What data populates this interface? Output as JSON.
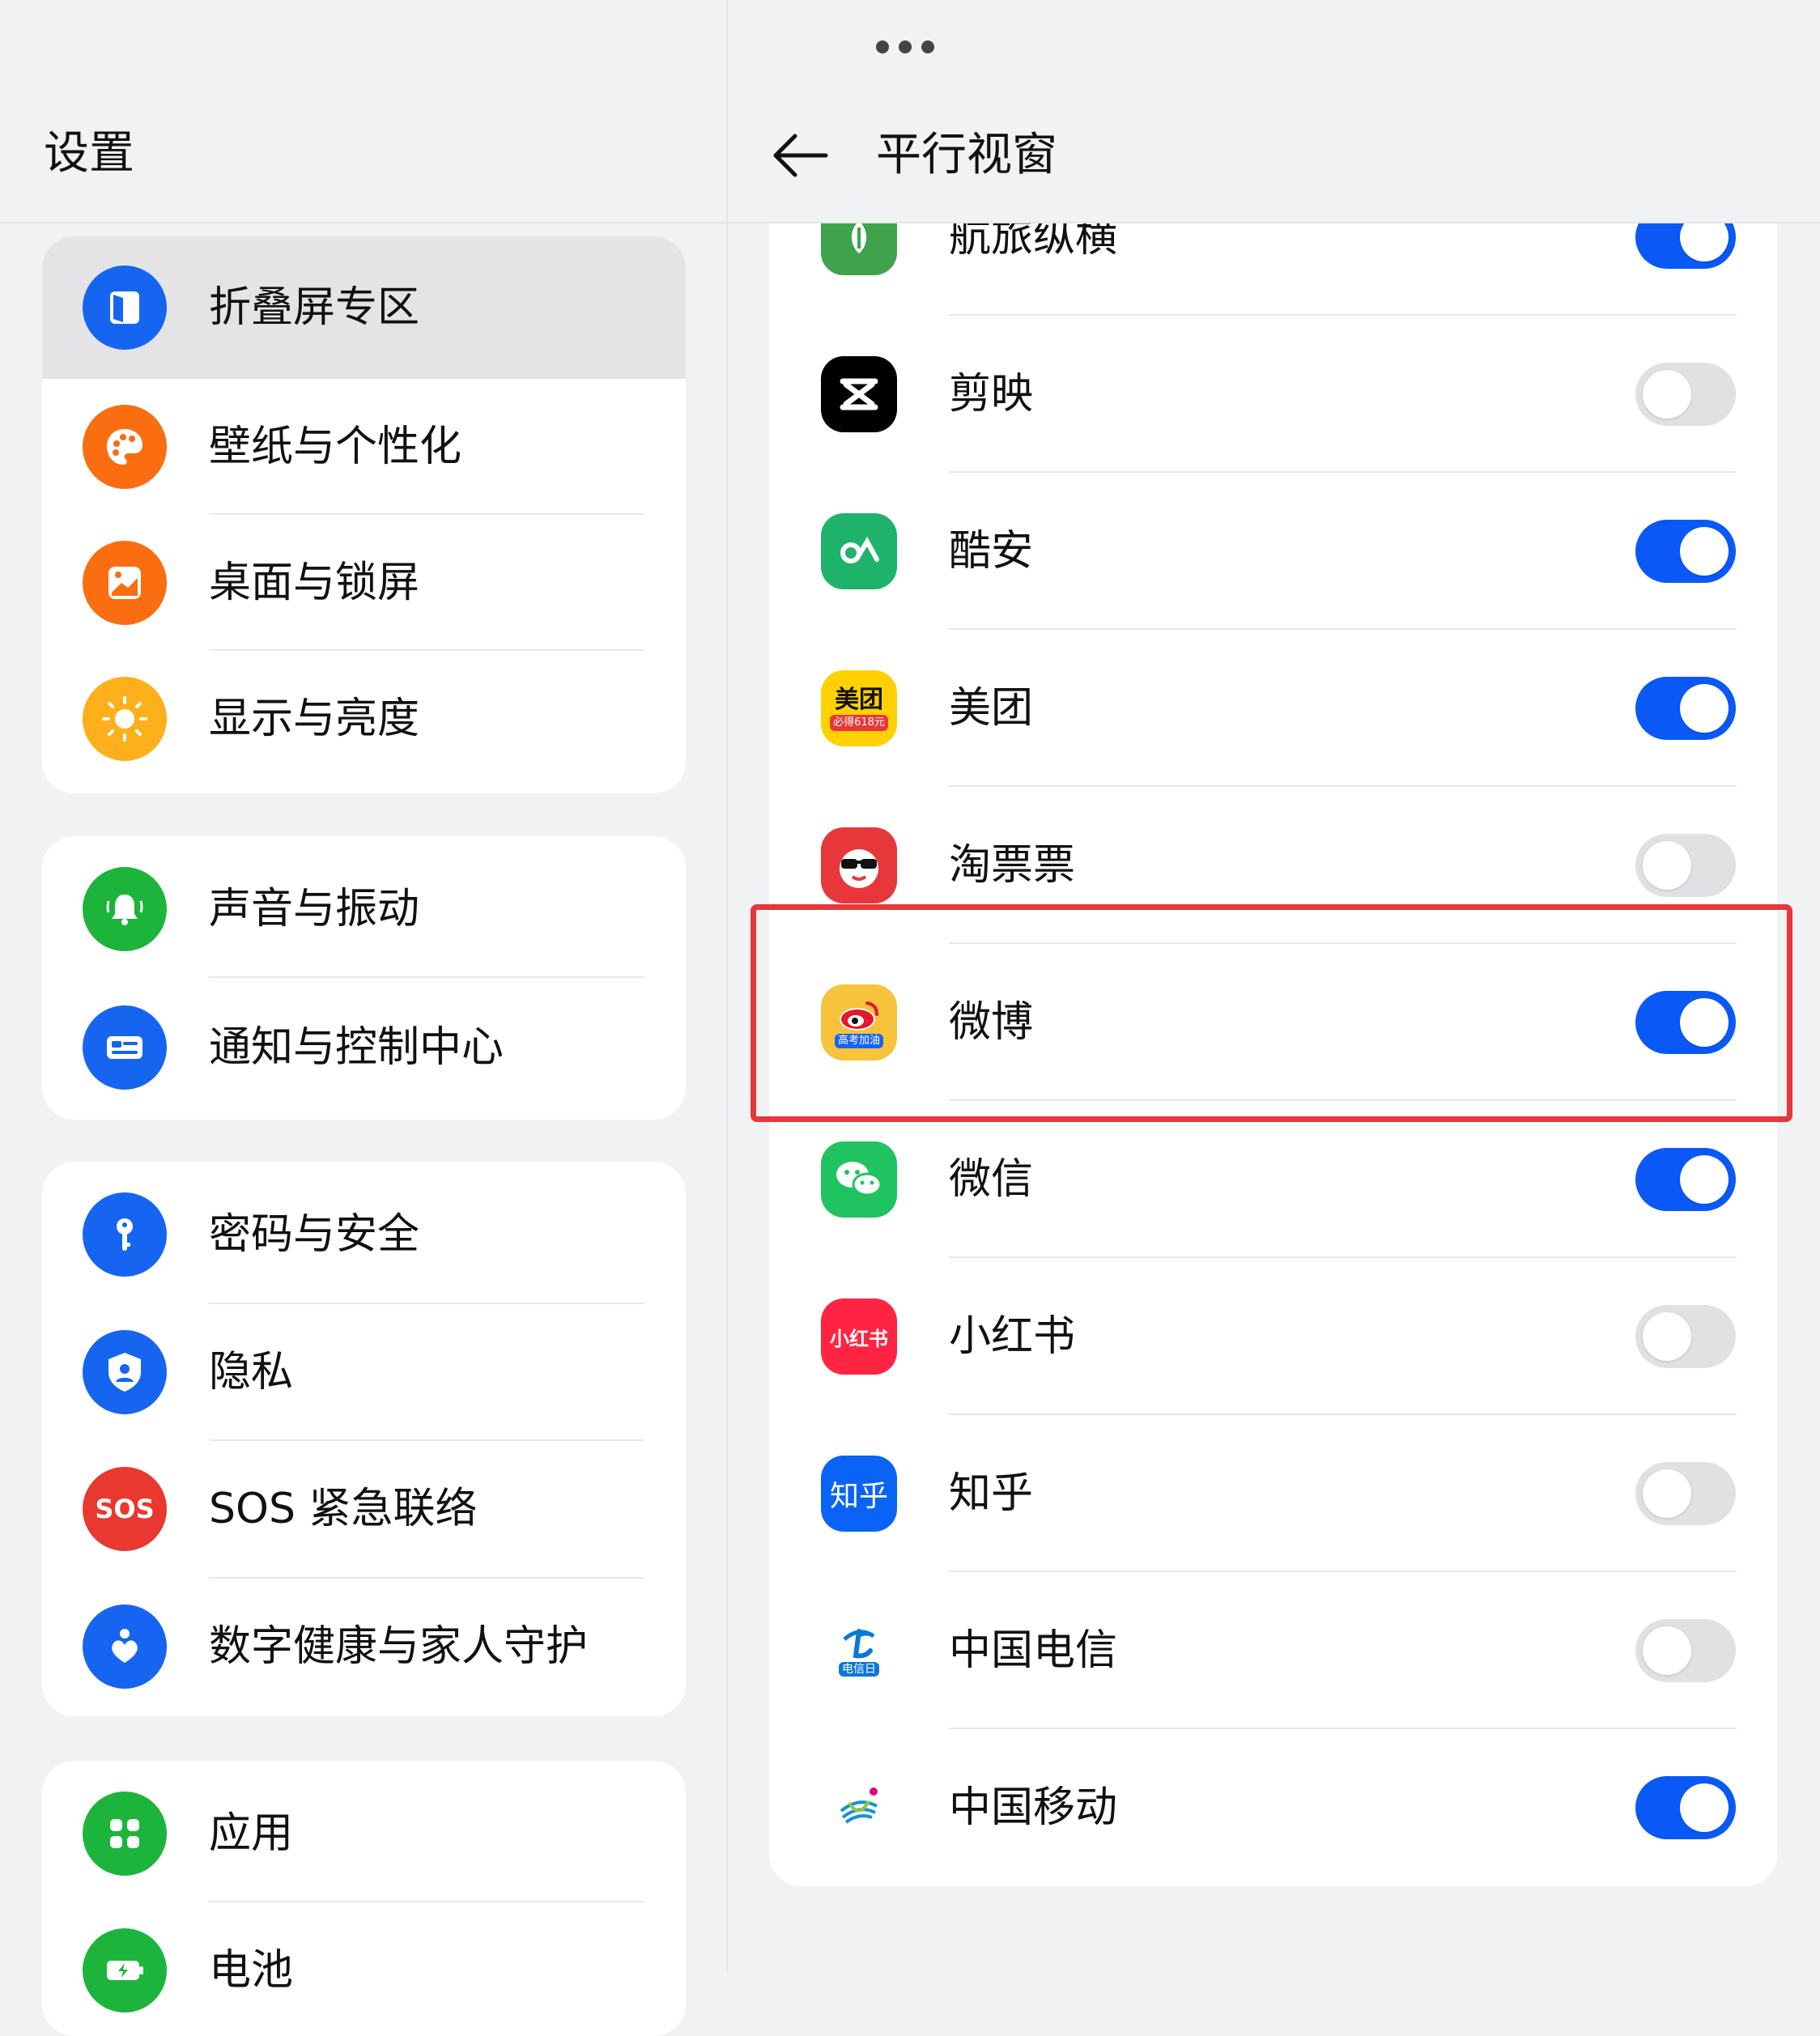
{
  "left": {
    "title": "设置",
    "items": [
      {
        "label": "折叠屏专区",
        "icon": "foldable-icon",
        "color": "#1565f0",
        "selected": true
      },
      {
        "label": "壁纸与个性化",
        "icon": "palette-icon",
        "color": "#fa6d10"
      },
      {
        "label": "桌面与锁屏",
        "icon": "wallpaper-icon",
        "color": "#fa6d10"
      },
      {
        "label": "显示与亮度",
        "icon": "sun-icon",
        "color": "#fdb01c"
      },
      {
        "label": "声音与振动",
        "icon": "bell-icon",
        "color": "#1db43c"
      },
      {
        "label": "通知与控制中心",
        "icon": "notification-icon",
        "color": "#1565f0"
      },
      {
        "label": "密码与安全",
        "icon": "key-icon",
        "color": "#1565f0"
      },
      {
        "label": "隐私",
        "icon": "privacy-shield-icon",
        "color": "#1565f0"
      },
      {
        "label": "SOS 紧急联络",
        "icon": "sos-icon",
        "icon_text": "SOS",
        "color": "#e8382f"
      },
      {
        "label": "数字健康与家人守护",
        "icon": "heart-person-icon",
        "color": "#1565f0"
      },
      {
        "label": "应用",
        "icon": "apps-grid-icon",
        "color": "#1db43c"
      },
      {
        "label": "电池",
        "icon": "battery-icon",
        "color": "#1db43c"
      }
    ]
  },
  "right": {
    "title": "平行视窗",
    "apps": [
      {
        "label": "航旅纵横",
        "icon": "hanglv-app-icon",
        "on": true,
        "color": "#3fa34d"
      },
      {
        "label": "剪映",
        "icon": "jianying-app-icon",
        "on": false,
        "color": "#000000"
      },
      {
        "label": "酷安",
        "icon": "coolapk-app-icon",
        "on": true,
        "color": "#1fb26b"
      },
      {
        "label": "美团",
        "icon": "meituan-app-icon",
        "icon_text": "美团",
        "icon_subtext": "必得618元",
        "on": true,
        "color": "#ffd100"
      },
      {
        "label": "淘票票",
        "icon": "taopiaopiao-app-icon",
        "on": false,
        "color": "#e8373b"
      },
      {
        "label": "微博",
        "icon": "weibo-app-icon",
        "icon_subtext": "高考加油",
        "on": true,
        "color": "#f7c23c",
        "highlighted": true
      },
      {
        "label": "微信",
        "icon": "wechat-app-icon",
        "on": true,
        "color": "#1fc360"
      },
      {
        "label": "小红书",
        "icon": "xiaohongshu-app-icon",
        "icon_text": "小红书",
        "on": false,
        "color": "#ff2442"
      },
      {
        "label": "知乎",
        "icon": "zhihu-app-icon",
        "icon_text": "知乎",
        "on": false,
        "color": "#0a63f7"
      },
      {
        "label": "中国电信",
        "icon": "china-telecom-app-icon",
        "icon_subtext": "电信日",
        "on": false,
        "color": "#0a78d6"
      },
      {
        "label": "中国移动",
        "icon": "china-mobile-app-icon",
        "on": true,
        "color": "#1793d1"
      }
    ]
  },
  "colors": {
    "accent": "#0a59f7",
    "highlight": "#e5383b",
    "toggle_off": "#e1e1e3"
  }
}
